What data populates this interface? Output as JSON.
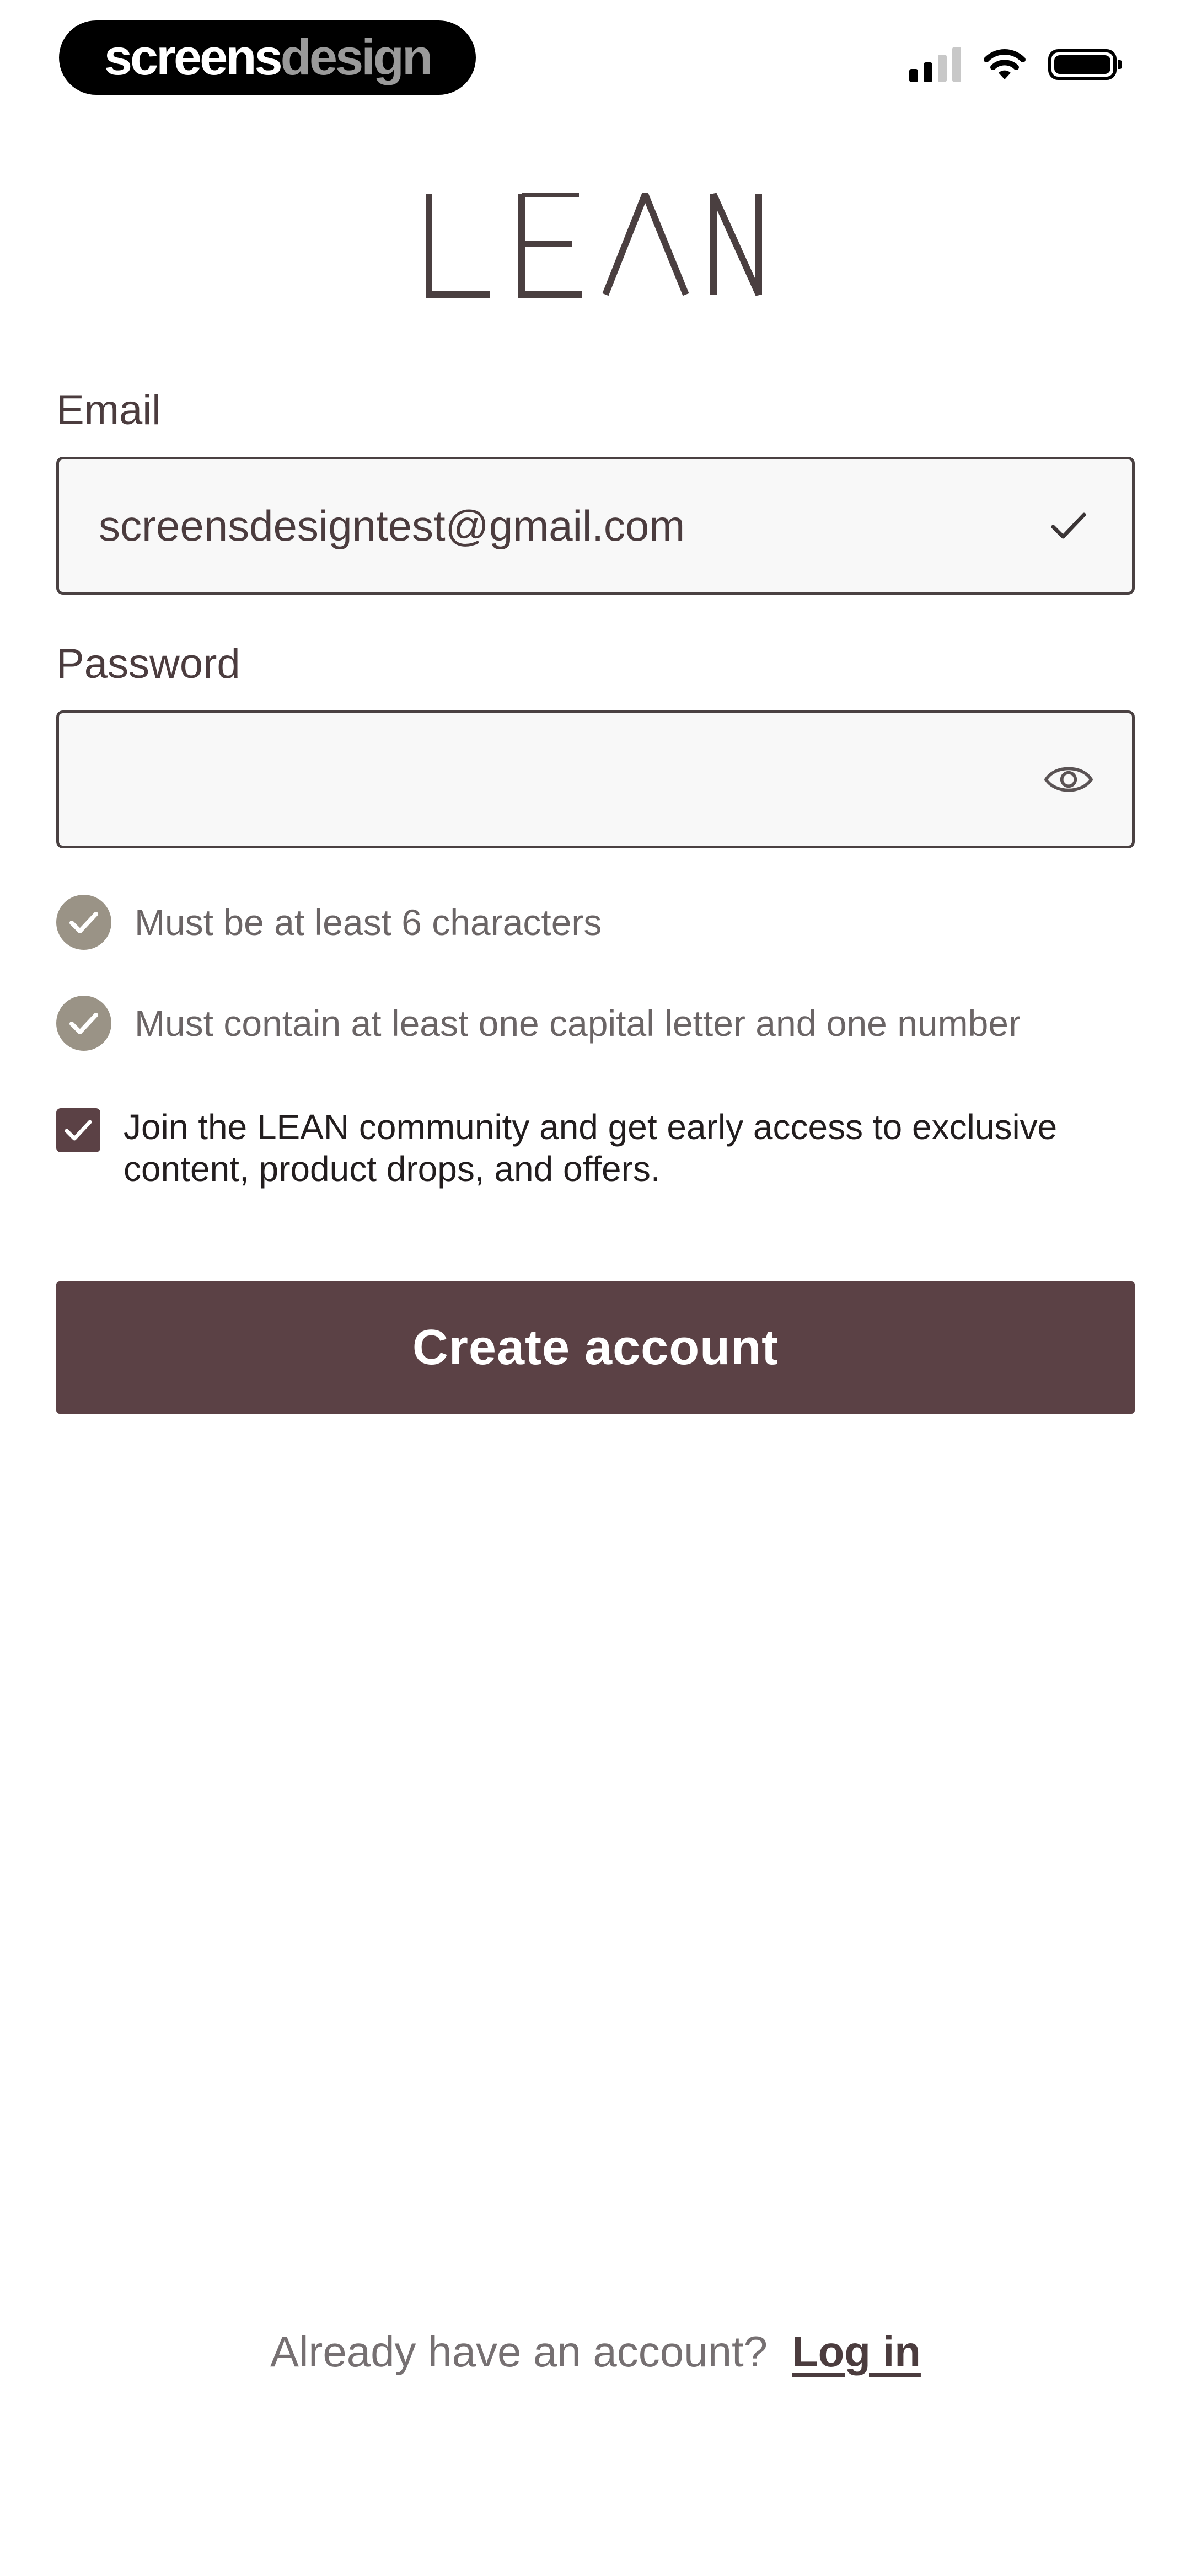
{
  "status_bar": {
    "watermark_part1": "screens",
    "watermark_part2": "design",
    "icons": [
      "signal-icon",
      "wifi-icon",
      "battery-icon"
    ]
  },
  "brand": {
    "logo_text": "LEAN"
  },
  "form": {
    "email_label": "Email",
    "email_value": "screensdesigntest@gmail.com",
    "email_valid_icon": "checkmark-icon",
    "password_label": "Password",
    "password_value": "",
    "password_toggle_icon": "eye-icon",
    "rules": [
      {
        "text": "Must be at least 6 characters",
        "met": true
      },
      {
        "text": "Must contain at least one capital letter and one number",
        "met": true
      }
    ],
    "consent_checked": true,
    "consent_text": "Join the LEAN community and get early access to exclusive content, product drops, and offers.",
    "submit_label": "Create account"
  },
  "footer": {
    "question": "Already have an account?",
    "login_link": "Log in"
  },
  "colors": {
    "brand": "#5b4145",
    "text_dark": "#4b3c3e",
    "rule_badge": "#9a9386",
    "input_bg": "#f8f8f8"
  }
}
